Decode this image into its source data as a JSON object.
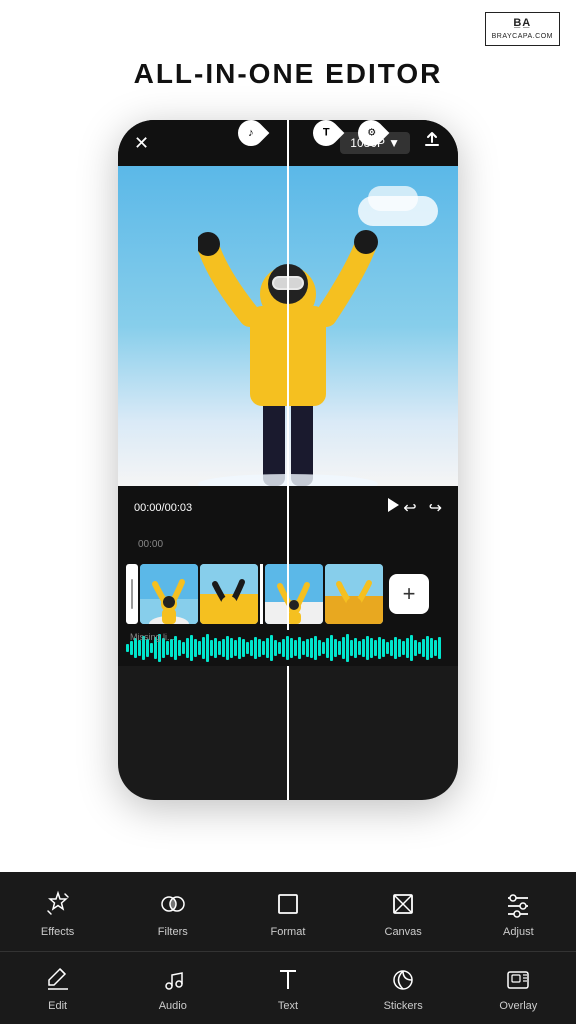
{
  "page": {
    "title": "ALL-IN-ONE EDITOR",
    "logo": {
      "line1": "B A",
      "line2": "BRAYCAPA.COM"
    }
  },
  "phone": {
    "resolution": "1080P ▼",
    "close_icon": "✕",
    "export_icon": "⬆",
    "time_display": "00:00/00:03",
    "undo_icon": "↩",
    "redo_icon": "↪",
    "playhead_time": "00:00"
  },
  "markers": [
    {
      "icon": "♪",
      "type": "audio"
    },
    {
      "icon": "T",
      "type": "text"
    },
    {
      "icon": "⚙",
      "type": "sticker"
    }
  ],
  "tools": [
    {
      "id": "effects",
      "label": "Effects",
      "icon": "effects"
    },
    {
      "id": "filters",
      "label": "Filters",
      "icon": "filters"
    },
    {
      "id": "format",
      "label": "Format",
      "icon": "format"
    },
    {
      "id": "canvas",
      "label": "Canvas",
      "icon": "canvas"
    },
    {
      "id": "adjust",
      "label": "Adjust",
      "icon": "adjust"
    }
  ],
  "nav": [
    {
      "id": "edit",
      "label": "Edit",
      "icon": "edit"
    },
    {
      "id": "audio",
      "label": "Audio",
      "icon": "audio"
    },
    {
      "id": "text",
      "label": "Text",
      "icon": "text"
    },
    {
      "id": "stickers",
      "label": "Stickers",
      "icon": "stickers"
    },
    {
      "id": "overlay",
      "label": "Overlay",
      "icon": "overlay"
    }
  ]
}
